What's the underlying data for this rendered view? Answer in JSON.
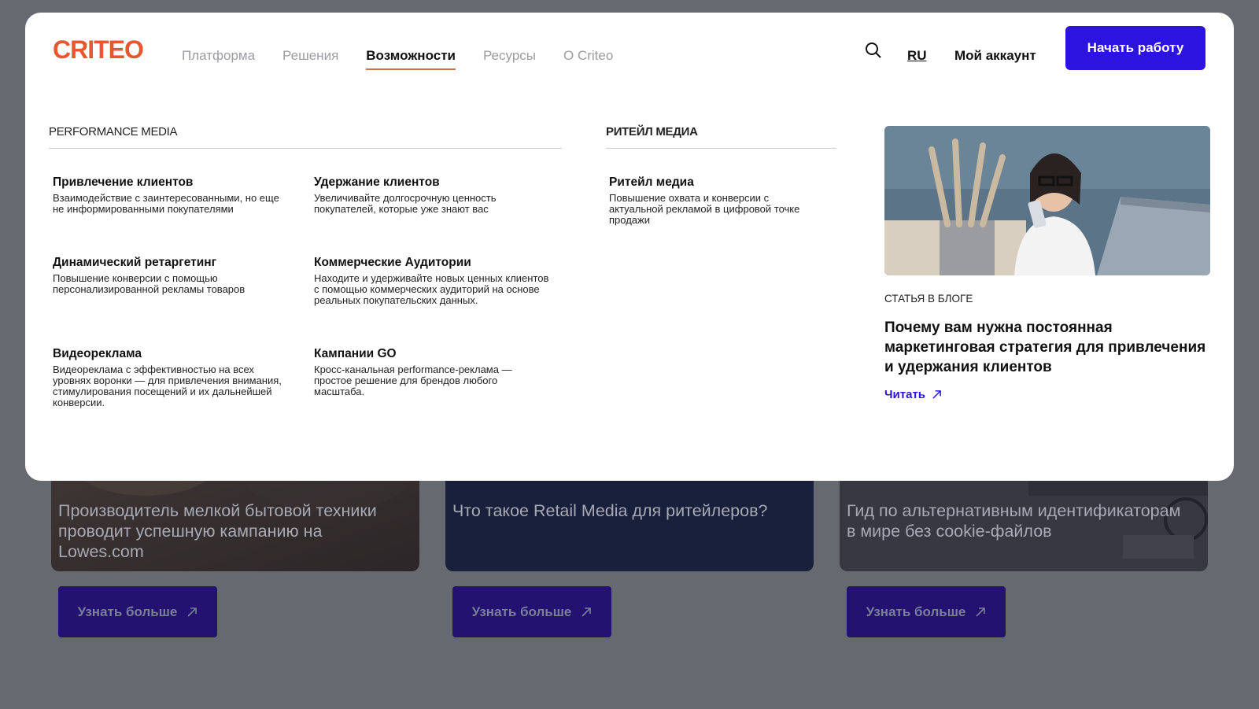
{
  "header": {
    "logo_text": "CRITEO",
    "nav": [
      "Платформа",
      "Решения",
      "Возможности",
      "Ресурсы",
      "О Criteo"
    ],
    "active_nav": "Возможности",
    "lang": "RU",
    "account": "Мой аккаунт",
    "cta": "Начать работу"
  },
  "performance": {
    "title": "PERFORMANCE MEDIA",
    "items": [
      {
        "title": "Привлечение клиентов",
        "desc": "Взаимодействие с заинтересованными, но еще не информированными покупателями"
      },
      {
        "title": "Удержание клиентов",
        "desc": "Увеличивайте долгосрочную ценность покупателей, которые уже знают вас"
      },
      {
        "title": "Динамический ретаргетинг",
        "desc": "Повышение конверсии с помощью персонализированной рекламы товаров"
      },
      {
        "title": "Коммерческие Аудитории",
        "desc": "Находите и удерживайте новых ценных клиентов с помощью коммерческих аудиторий на основе реальных покупательских данных."
      },
      {
        "title": "Видеореклама",
        "desc": "Видеореклама с эффективностью на всех уровнях воронки — для привлечения внимания, стимулирования посещений и их дальнейшей конверсии."
      },
      {
        "title": "Кампании GO",
        "desc": "Кросс-канальная performance-реклама — простое решение для брендов любого масштаба."
      }
    ]
  },
  "retail": {
    "title": "РИТЕЙЛ МЕДИА",
    "items": [
      {
        "title": "Ритейл медиа",
        "desc": "Повышение охвата и конверсии с актуальной рекламой в цифровой точке продажи"
      }
    ]
  },
  "blog": {
    "label": "СТАТЬЯ В БЛОГЕ",
    "title": "Почему вам нужна постоянная маркетинговая стратегия для привлечения и удержания клиентов",
    "read": "Читать"
  },
  "background_cards": [
    {
      "caption": "Производитель мелкой бытовой техники проводит успешную кампанию на Lowes.com",
      "button": "Узнать больше"
    },
    {
      "caption": "Что такое Retail Media для ритейлеров?",
      "button": "Узнать больше"
    },
    {
      "caption": "Гид по альтернативным идентификаторам в мире без cookie-файлов",
      "button": "Узнать больше"
    }
  ],
  "colors": {
    "accent": "#2d13e0",
    "logo": "#e8572f",
    "underline": "#c9744b",
    "overlay": "#666a70"
  }
}
